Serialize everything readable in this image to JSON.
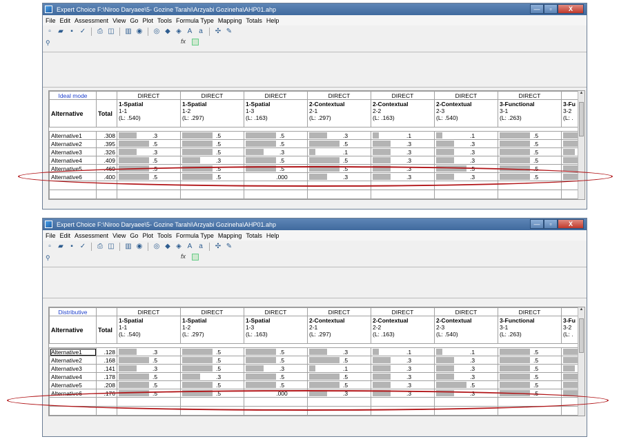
{
  "windows": [
    {
      "title": "Expert Choice    F:\\Niroo Daryaee\\5- Gozine Tarahi\\Arzyabi Gozineha\\AHP01.ahp",
      "controls": {
        "min": "—",
        "max": "▫",
        "close": "X"
      },
      "menu": [
        "File",
        "Edit",
        "Assessment",
        "View",
        "Go",
        "Plot",
        "Tools",
        "Formula Type",
        "Mapping",
        "Totals",
        "Help"
      ],
      "mode": "Ideal mode",
      "header": {
        "direct": [
          "DIRECT",
          "DIRECT",
          "DIRECT",
          "DIRECT",
          "DIRECT",
          "DIRECT",
          "DIRECT"
        ],
        "criteria": [
          {
            "name": "1-Spatial",
            "code": "1-1",
            "weight": "(L: .540)"
          },
          {
            "name": "1-Spatial",
            "code": "1-2",
            "weight": "(L: .297)"
          },
          {
            "name": "1-Spatial",
            "code": "1-3",
            "weight": "(L: .163)"
          },
          {
            "name": "2-Contextual",
            "code": "2-1",
            "weight": "(L: .297)"
          },
          {
            "name": "2-Contextual",
            "code": "2-2",
            "weight": "(L: .163)"
          },
          {
            "name": "2-Contextual",
            "code": "2-3",
            "weight": "(L: .540)"
          },
          {
            "name": "3-Functional",
            "code": "3-1",
            "weight": "(L: .263)"
          },
          {
            "name": "3-Fu",
            "code": "3-2",
            "weight": "(L: ."
          }
        ],
        "alternative_label": "Alternative",
        "total_label": "Total"
      },
      "rows": [
        {
          "name": "Alternative1",
          "total": ".308",
          "values": [
            ".3",
            ".5",
            ".5",
            ".3",
            ".1",
            ".1",
            ".5",
            ""
          ],
          "fill": [
            0.6,
            1,
            1,
            0.6,
            0.2,
            0.2,
            1,
            1
          ],
          "selected": false
        },
        {
          "name": "Alternative2",
          "total": ".395",
          "values": [
            ".5",
            ".5",
            ".5",
            ".5",
            ".3",
            ".3",
            ".5",
            ""
          ],
          "fill": [
            1,
            1,
            1,
            1,
            0.6,
            0.6,
            1,
            1
          ],
          "selected": false
        },
        {
          "name": "Alternative3",
          "total": ".326",
          "values": [
            ".3",
            ".5",
            ".3",
            ".1",
            ".3",
            ".3",
            ".5",
            ""
          ],
          "fill": [
            0.6,
            1,
            0.6,
            0.2,
            0.6,
            0.6,
            1,
            0.6
          ],
          "selected": false
        },
        {
          "name": "Alternative4",
          "total": ".409",
          "values": [
            ".5",
            ".3",
            ".5",
            ".5",
            ".3",
            ".3",
            ".5",
            ""
          ],
          "fill": [
            1,
            0.6,
            1,
            1,
            0.6,
            0.6,
            1,
            1
          ],
          "selected": false
        },
        {
          "name": "Alternative5",
          "total": ".469",
          "values": [
            ".5",
            ".5",
            ".5",
            ".5",
            ".3",
            ".5",
            ".5",
            ""
          ],
          "fill": [
            1,
            1,
            1,
            1,
            0.6,
            1,
            1,
            1
          ],
          "selected": false
        },
        {
          "name": "Alternative6",
          "total": ".400",
          "values": [
            ".5",
            ".5",
            ".000",
            ".3",
            ".3",
            ".3",
            ".5",
            ""
          ],
          "fill": [
            1,
            1,
            0,
            0.6,
            0.6,
            0.6,
            1,
            1
          ],
          "selected": false
        }
      ],
      "highlighted_row": "Alternative5"
    },
    {
      "title": "Expert Choice    F:\\Niroo Daryaee\\5- Gozine Tarahi\\Arzyabi Gozineha\\AHP01.ahp",
      "controls": {
        "min": "—",
        "max": "▫",
        "close": "X"
      },
      "menu": [
        "File",
        "Edit",
        "Assessment",
        "View",
        "Go",
        "Plot",
        "Tools",
        "Formula Type",
        "Mapping",
        "Totals",
        "Help"
      ],
      "mode": "Distributive",
      "header": {
        "direct": [
          "DIRECT",
          "DIRECT",
          "DIRECT",
          "DIRECT",
          "DIRECT",
          "DIRECT",
          "DIRECT"
        ],
        "criteria": [
          {
            "name": "1-Spatial",
            "code": "1-1",
            "weight": "(L: .540)"
          },
          {
            "name": "1-Spatial",
            "code": "1-2",
            "weight": "(L: .297)"
          },
          {
            "name": "1-Spatial",
            "code": "1-3",
            "weight": "(L: .163)"
          },
          {
            "name": "2-Contextual",
            "code": "2-1",
            "weight": "(L: .297)"
          },
          {
            "name": "2-Contextual",
            "code": "2-2",
            "weight": "(L: .163)"
          },
          {
            "name": "2-Contextual",
            "code": "2-3",
            "weight": "(L: .540)"
          },
          {
            "name": "3-Functional",
            "code": "3-1",
            "weight": "(L: .263)"
          },
          {
            "name": "3-Fu",
            "code": "3-2",
            "weight": "(L: ."
          }
        ],
        "alternative_label": "Alternative",
        "total_label": "Total"
      },
      "rows": [
        {
          "name": "Alternative1",
          "total": ".128",
          "values": [
            ".3",
            ".5",
            ".5",
            ".3",
            ".1",
            ".1",
            ".5",
            ""
          ],
          "fill": [
            0.6,
            1,
            1,
            0.6,
            0.2,
            0.2,
            1,
            1
          ],
          "selected": true
        },
        {
          "name": "Alternative2",
          "total": ".168",
          "values": [
            ".5",
            ".5",
            ".5",
            ".5",
            ".3",
            ".3",
            ".5",
            ""
          ],
          "fill": [
            1,
            1,
            1,
            1,
            0.6,
            0.6,
            1,
            1
          ],
          "selected": false
        },
        {
          "name": "Alternative3",
          "total": ".141",
          "values": [
            ".3",
            ".5",
            ".3",
            ".1",
            ".3",
            ".3",
            ".5",
            ""
          ],
          "fill": [
            0.6,
            1,
            0.6,
            0.2,
            0.6,
            0.6,
            1,
            0.6
          ],
          "selected": false
        },
        {
          "name": "Alternative4",
          "total": ".178",
          "values": [
            ".5",
            ".3",
            ".5",
            ".5",
            ".3",
            ".3",
            ".5",
            ""
          ],
          "fill": [
            1,
            0.6,
            1,
            1,
            0.6,
            0.6,
            1,
            1
          ],
          "selected": false
        },
        {
          "name": "Alternative5",
          "total": ".208",
          "values": [
            ".5",
            ".5",
            ".5",
            ".5",
            ".3",
            ".5",
            ".5",
            ""
          ],
          "fill": [
            1,
            1,
            1,
            1,
            0.6,
            1,
            1,
            1
          ],
          "selected": false
        },
        {
          "name": "Alternative6",
          "total": ".176",
          "values": [
            ".5",
            ".5",
            ".000",
            ".3",
            ".3",
            ".3",
            ".5",
            ""
          ],
          "fill": [
            1,
            1,
            0,
            0.6,
            0.6,
            0.6,
            1,
            1
          ],
          "selected": false
        }
      ],
      "highlighted_row": "Alternative5"
    }
  ],
  "toolbar_icons": [
    "new-icon",
    "open-icon",
    "save-icon",
    "check-icon",
    "print-icon",
    "preview-icon",
    "chart-icon",
    "camera-icon",
    "globe-icon",
    "sync-icon",
    "flag-icon",
    "font-up-icon",
    "font-down-icon",
    "split-icon",
    "tool-icon"
  ],
  "colors": {
    "titlebar": "#4a75aa",
    "bar": "#b4b4b4",
    "highlight": "#b11518",
    "mode_text": "#1d3fcc"
  }
}
